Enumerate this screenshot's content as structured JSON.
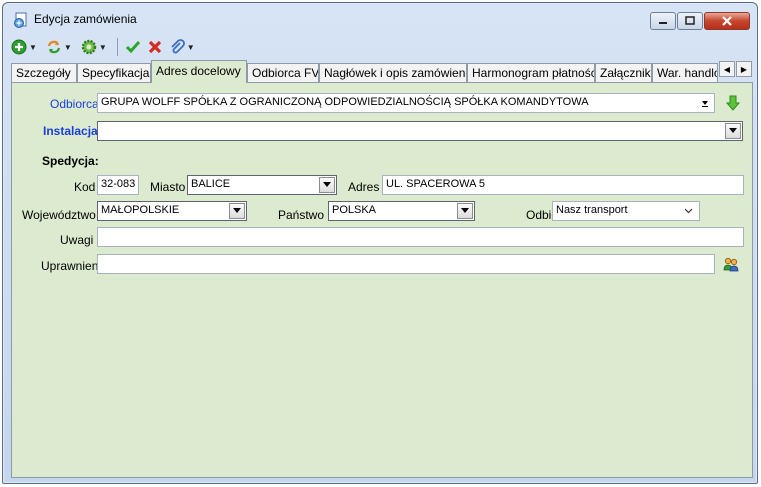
{
  "window": {
    "title": "Edycja zamówienia"
  },
  "tabs": [
    {
      "label": "Szczegóły"
    },
    {
      "label": "Specyfikacja"
    },
    {
      "label": "Adres docelowy"
    },
    {
      "label": "Odbiorca FV"
    },
    {
      "label": "Nagłówek i opis zamówienia"
    },
    {
      "label": "Harmonogram płatności"
    },
    {
      "label": "Załączniki"
    },
    {
      "label": "War. handlo"
    }
  ],
  "form": {
    "odbiorca_label": "Odbiorca",
    "odbiorca_value": "GRUPA WOLFF SPÓŁKA Z OGRANICZONĄ ODPOWIEDZIALNOŚCIĄ SPÓŁKA KOMANDYTOWA",
    "instalacja_label": "Instalacja",
    "instalacja_value": "",
    "spedycja_label": "Spedycja:",
    "kod_label": "Kod",
    "kod_value": "32-083",
    "miasto_label": "Miasto",
    "miasto_value": "BALICE",
    "adres_label": "Adres",
    "adres_value": "UL. SPACEROWA 5",
    "wojewodztwo_label": "Województwo",
    "wojewodztwo_value": "MAŁOPOLSKIE",
    "panstwo_label": "Państwo",
    "panstwo_value": "POLSKA",
    "odbior_label": "Odbiór",
    "odbior_value": "Nasz transport",
    "uwagi_label": "Uwagi",
    "uwagi_value": "",
    "uprawnieni_label": "Uprawnieni",
    "uprawnieni_value": ""
  },
  "icons": {
    "app": "order-window-icon",
    "add": "add-icon",
    "refresh": "refresh-icon",
    "settings": "gear-icon",
    "confirm": "check-icon",
    "cancel": "cross-icon",
    "attach": "paperclip-icon",
    "pick_down": "green-arrow-down-icon",
    "users": "users-icon"
  },
  "colors": {
    "panel_bg": "#dcebd0",
    "label_blue": "#1a3fd6",
    "confirm_green": "#2aa52a",
    "cancel_red": "#d62b1f"
  }
}
